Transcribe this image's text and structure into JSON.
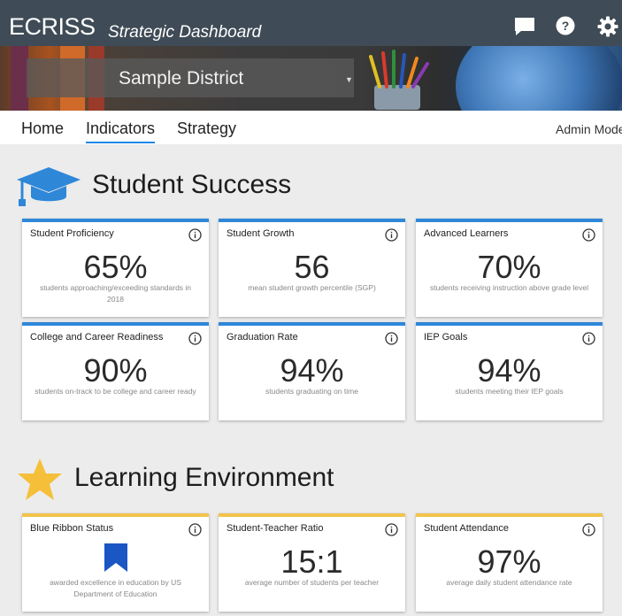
{
  "header": {
    "brand": "ECRISS",
    "subtitle": "Strategic Dashboard",
    "icons": [
      "chat-icon",
      "help-icon",
      "gear-icon"
    ]
  },
  "banner": {
    "district": "Sample District"
  },
  "nav": {
    "tabs": [
      {
        "label": "Home",
        "active": false
      },
      {
        "label": "Indicators",
        "active": true
      },
      {
        "label": "Strategy",
        "active": false
      }
    ],
    "admin_mode": "Admin Mode"
  },
  "sections": [
    {
      "title": "Student Success",
      "icon": "graduation-cap-icon",
      "accent": "#2f87d8",
      "cards": [
        {
          "title": "Student Proficiency",
          "value": "65%",
          "description": "students approaching/exceeding standards in 2018"
        },
        {
          "title": "Student Growth",
          "value": "56",
          "description": "mean student growth percentile (SGP)"
        },
        {
          "title": "Advanced Learners",
          "value": "70%",
          "description": "students receiving instruction above grade level"
        },
        {
          "title": "College and Career Readiness",
          "value": "90%",
          "description": "students on-track to be college and career ready"
        },
        {
          "title": "Graduation Rate",
          "value": "94%",
          "description": "students graduating on time"
        },
        {
          "title": "IEP Goals",
          "value": "94%",
          "description": "students meeting their IEP goals"
        }
      ]
    },
    {
      "title": "Learning Environment",
      "icon": "star-icon",
      "accent": "#f2c44a",
      "cards": [
        {
          "title": "Blue Ribbon Status",
          "value": "",
          "icon": "bookmark-ribbon-icon",
          "description": "awarded excellence in education by US Department of Education"
        },
        {
          "title": "Student-Teacher Ratio",
          "value": "15:1",
          "description": "average number of students per teacher"
        },
        {
          "title": "Student Attendance",
          "value": "97%",
          "description": "average daily student attendance rate"
        }
      ]
    }
  ],
  "colors": {
    "topbar": "#3f4b56",
    "active_tab_underline": "#1e88e5",
    "success_accent": "#2f87d8",
    "environment_accent": "#f2c44a",
    "ribbon": "#1a56c4"
  }
}
